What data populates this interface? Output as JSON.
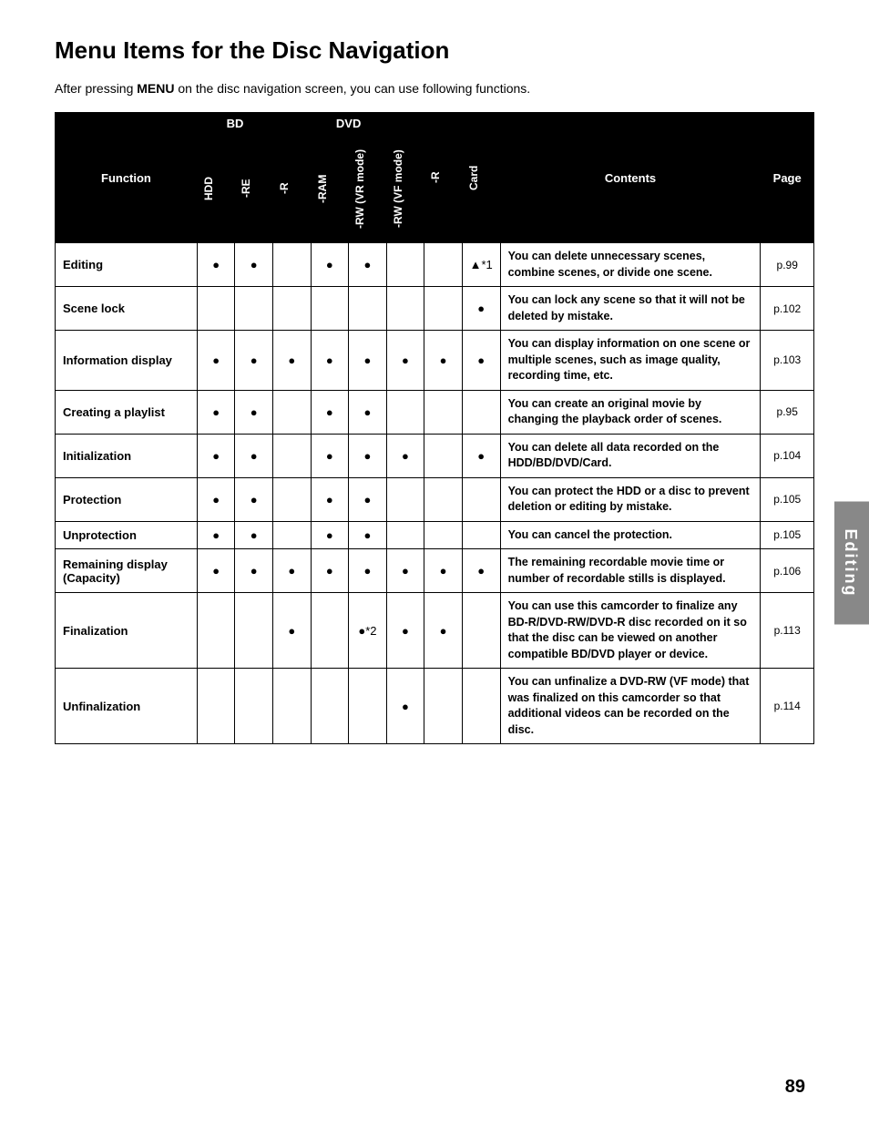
{
  "title": "Menu Items for the Disc Navigation",
  "intro": {
    "text": "After pressing ",
    "bold": "MENU",
    "text2": " on the disc navigation screen, you can use following functions."
  },
  "table": {
    "col_groups": [
      {
        "label": "BD",
        "colspan": 2
      },
      {
        "label": "DVD",
        "colspan": 4
      }
    ],
    "headers": [
      {
        "label": "Function",
        "rotated": false
      },
      {
        "label": "HDD",
        "rotated": true
      },
      {
        "label": "-RE",
        "rotated": true
      },
      {
        "label": "-R",
        "rotated": true
      },
      {
        "label": "-RAM",
        "rotated": true
      },
      {
        "label": "-RW (VR mode)",
        "rotated": true
      },
      {
        "label": "-RW (VF mode)",
        "rotated": true
      },
      {
        "label": "-R",
        "rotated": true
      },
      {
        "label": "Card",
        "rotated": true
      },
      {
        "label": "Contents",
        "rotated": false
      },
      {
        "label": "Page",
        "rotated": false
      }
    ],
    "rows": [
      {
        "function": "Editing",
        "hdd": "●",
        "re": "●",
        "r1": "",
        "ram": "●",
        "rw_vr": "●",
        "rw_vf": "",
        "r2": "",
        "card": "▲*1",
        "contents": "You can delete unnecessary scenes, combine scenes, or divide one scene.",
        "page": "p.99"
      },
      {
        "function": "Scene lock",
        "hdd": "",
        "re": "",
        "r1": "",
        "ram": "",
        "rw_vr": "",
        "rw_vf": "",
        "r2": "",
        "card": "●",
        "contents": "You can lock any scene so that it will not be deleted by mistake.",
        "page": "p.102"
      },
      {
        "function": "Information display",
        "hdd": "●",
        "re": "●",
        "r1": "●",
        "ram": "●",
        "rw_vr": "●",
        "rw_vf": "●",
        "r2": "●",
        "card": "●",
        "contents": "You can display information on one scene or multiple scenes, such as image quality, recording time, etc.",
        "page": "p.103"
      },
      {
        "function": "Creating a playlist",
        "hdd": "●",
        "re": "●",
        "r1": "",
        "ram": "●",
        "rw_vr": "●",
        "rw_vf": "",
        "r2": "",
        "card": "",
        "contents": "You can create an original movie by changing the playback order of scenes.",
        "page": "p.95"
      },
      {
        "function": "Initialization",
        "hdd": "●",
        "re": "●",
        "r1": "",
        "ram": "●",
        "rw_vr": "●",
        "rw_vf": "●",
        "r2": "",
        "card": "●",
        "contents": "You can delete all data recorded on the HDD/BD/DVD/Card.",
        "page": "p.104"
      },
      {
        "function": "Protection",
        "hdd": "●",
        "re": "●",
        "r1": "",
        "ram": "●",
        "rw_vr": "●",
        "rw_vf": "",
        "r2": "",
        "card": "",
        "contents": "You can protect the HDD or a disc to prevent deletion or editing by mistake.",
        "page": "p.105"
      },
      {
        "function": "Unprotection",
        "hdd": "●",
        "re": "●",
        "r1": "",
        "ram": "●",
        "rw_vr": "●",
        "rw_vf": "",
        "r2": "",
        "card": "",
        "contents": "You can cancel the protection.",
        "page": "p.105"
      },
      {
        "function": "Remaining display (Capacity)",
        "hdd": "●",
        "re": "●",
        "r1": "●",
        "ram": "●",
        "rw_vr": "●",
        "rw_vf": "●",
        "r2": "●",
        "card": "●",
        "contents": "The remaining recordable movie time or number of recordable stills is displayed.",
        "page": "p.106"
      },
      {
        "function": "Finalization",
        "hdd": "",
        "re": "",
        "r1": "●",
        "ram": "",
        "rw_vr": "●*2",
        "rw_vf": "●",
        "r2": "●",
        "card": "",
        "contents": "You can use this camcorder to finalize any BD-R/DVD-RW/DVD-R disc recorded on it so that the disc can be viewed on another compatible BD/DVD player or device.",
        "page": "p.113"
      },
      {
        "function": "Unfinalization",
        "hdd": "",
        "re": "",
        "r1": "",
        "ram": "",
        "rw_vr": "",
        "rw_vf": "●",
        "r2": "",
        "card": "",
        "contents": "You can unfinalize a DVD-RW (VF mode) that was finalized on this camcorder so that additional videos can be recorded on the disc.",
        "page": "p.114"
      }
    ]
  },
  "side_tab": "Editing",
  "page_number": "89"
}
